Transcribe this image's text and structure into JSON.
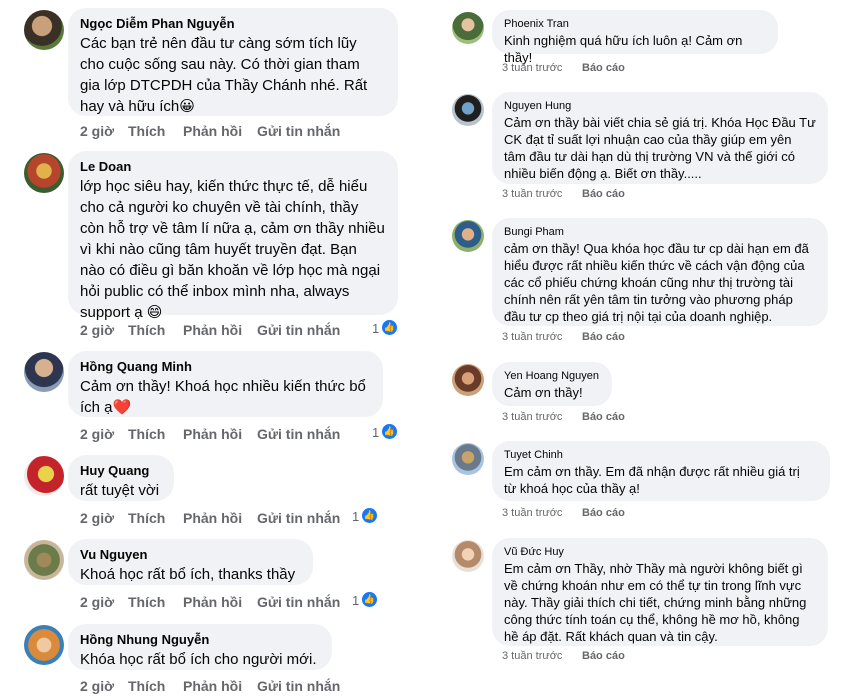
{
  "left": {
    "comments": [
      {
        "name": "Ngọc Diễm Phan Nguyễn",
        "lines": [
          "Các bạn trẻ nên đầu tư càng sớm tích lũy",
          "cho cuộc sống sau này. Có thời gian tham",
          "gia lớp DTCPDH của Thầy Chánh nhé. Rất",
          "hay và hữu ích😀"
        ],
        "time": "2 giờ",
        "like": "Thích",
        "reply": "Phản hồi",
        "message": "Gửi tin nhắn",
        "reactions": ""
      },
      {
        "name": "Le Doan",
        "lines": [
          "lớp học siêu hay, kiến thức thực tế, dễ hiểu",
          "cho cả người ko chuyên về tài chính, thầy",
          "còn hỗ trợ về tâm lí nữa ạ, cảm ơn thầy nhiều",
          "vì khi nào cũng tâm huyết truyền đạt. Bạn",
          "nào có điều gì băn khoăn về lớp học  mà ngại",
          "hỏi public có thể inbox mình nha, always",
          "support ạ 😄"
        ],
        "time": "2 giờ",
        "like": "Thích",
        "reply": "Phản hồi",
        "message": "Gửi tin nhắn",
        "reactions": "1"
      },
      {
        "name": "Hồng Quang Minh",
        "lines": [
          "Cảm ơn thầy! Khoá học nhiều kiến thức bổ",
          "ích ạ❤️"
        ],
        "time": "2 giờ",
        "like": "Thích",
        "reply": "Phản hồi",
        "message": "Gửi tin nhắn",
        "reactions": "1"
      },
      {
        "name": "Huy Quang",
        "lines": [
          "rất tuyệt vời"
        ],
        "time": "2 giờ",
        "like": "Thích",
        "reply": "Phản hồi",
        "message": "Gửi tin nhắn",
        "reactions": "1"
      },
      {
        "name": "Vu Nguyen",
        "lines": [
          "Khoá học rất bổ ích, thanks thầy"
        ],
        "time": "2 giờ",
        "like": "Thích",
        "reply": "Phản hồi",
        "message": "Gửi tin nhắn",
        "reactions": "1"
      },
      {
        "name": "Hồng Nhung Nguyễn",
        "lines": [
          "Khóa học rất bổ ích cho người mới."
        ],
        "time": "2 giờ",
        "like": "Thích",
        "reply": "Phản hồi",
        "message": "Gửi tin nhắn",
        "reactions": ""
      }
    ]
  },
  "right": {
    "comments": [
      {
        "name": "Phoenix Tran",
        "lines": [
          "Kinh nghiệm quá hữu ích luôn ạ! Cảm ơn thầy!"
        ],
        "time": "3 tuần trước",
        "report": "Báo cáo"
      },
      {
        "name": "Nguyen Hung",
        "lines": [
          "Cảm ơn thầy bài viết chia sẻ giá trị. Khóa Học Đầu Tư",
          "CK đạt tỉ suất lợi nhuận cao của thầy giúp em yên",
          "tâm đầu tư dài hạn dù thị trường VN và thế giới có",
          "nhiều biến động ạ. Biết ơn thầy....."
        ],
        "time": "3 tuần trước",
        "report": "Báo cáo"
      },
      {
        "name": "Bungi Pham",
        "lines": [
          "cảm ơn thầy! Qua khóa học đầu tư cp dài hạn em đã",
          "hiểu được rất nhiều kiến thức về cách vận động của",
          "các cổ phiếu chứng khoán cũng như thị trường tài",
          "chính nên rất yên tâm tin tưởng vào phương pháp",
          "đầu tư cp theo giá trị nội tại của doanh nghiệp."
        ],
        "time": "3 tuần trước",
        "report": "Báo cáo"
      },
      {
        "name": "Yen Hoang Nguyen",
        "lines": [
          "Cảm ơn thầy!"
        ],
        "time": "3 tuần trước",
        "report": "Báo cáo"
      },
      {
        "name": "Tuyet Chinh",
        "lines": [
          "Em cảm ơn thầy. Em đã nhận được rất nhiều giá trị",
          "từ khoá học của thầy ạ!"
        ],
        "time": "3 tuần trước",
        "report": "Báo cáo"
      },
      {
        "name": "Vũ Đức Huy",
        "lines": [
          "Em cảm ơn Thầy, nhờ Thầy mà người không biết gì",
          "về chứng khoán như em có thể tự tin trong lĩnh vực",
          "này. Thầy giải thích chi tiết, chứng minh bằng những",
          "công thức tính toán cụ thể, không hề mơ hồ, không",
          "hề áp đặt. Rất khách quan và tin cậy."
        ],
        "time": "3 tuần trước",
        "report": "Báo cáo"
      }
    ]
  },
  "colors": {
    "bubble": "#f0f2f5",
    "meta": "#65676b",
    "text": "#050505",
    "like_blue": "#1877f2"
  }
}
